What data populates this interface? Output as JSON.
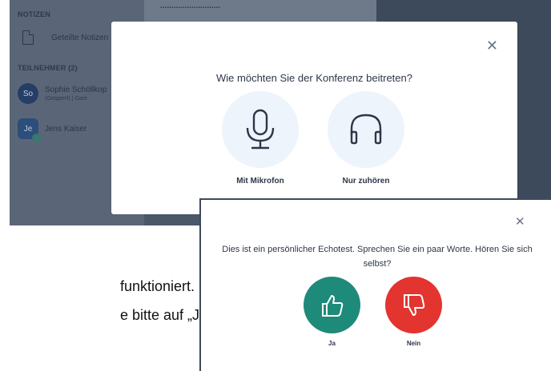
{
  "app": {
    "top_text": "...........................",
    "sidebar": {
      "notes_heading": "NOTIZEN",
      "shared_notes": "Geteilte Notizen",
      "participants_heading": "TEILNEHMER (2)",
      "participants": [
        {
          "initials": "So",
          "name": "Sophie Schöllkop",
          "status": "(Gesperrt) | Gast"
        },
        {
          "initials": "Je",
          "name": "Jens Kaiser",
          "status": ""
        }
      ]
    }
  },
  "join_modal": {
    "title": "Wie möchten Sie der Konferenz beitreten?",
    "close_icon": "close-icon",
    "options": [
      {
        "label": "Mit Mikrofon",
        "icon": "microphone-icon"
      },
      {
        "label": "Nur zuhören",
        "icon": "headphones-icon"
      }
    ]
  },
  "echo_modal": {
    "text": "Dies ist ein persönlicher Echotest. Sprechen Sie ein paar Worte. Hören Sie sich selbst?",
    "close_icon": "close-icon",
    "yes_label": "Ja",
    "no_label": "Nein",
    "yes_color": "#1e8a7a",
    "no_color": "#e3342f"
  },
  "document": {
    "line1": "funktioniert.",
    "line2": "e bitte auf „Ja“."
  }
}
